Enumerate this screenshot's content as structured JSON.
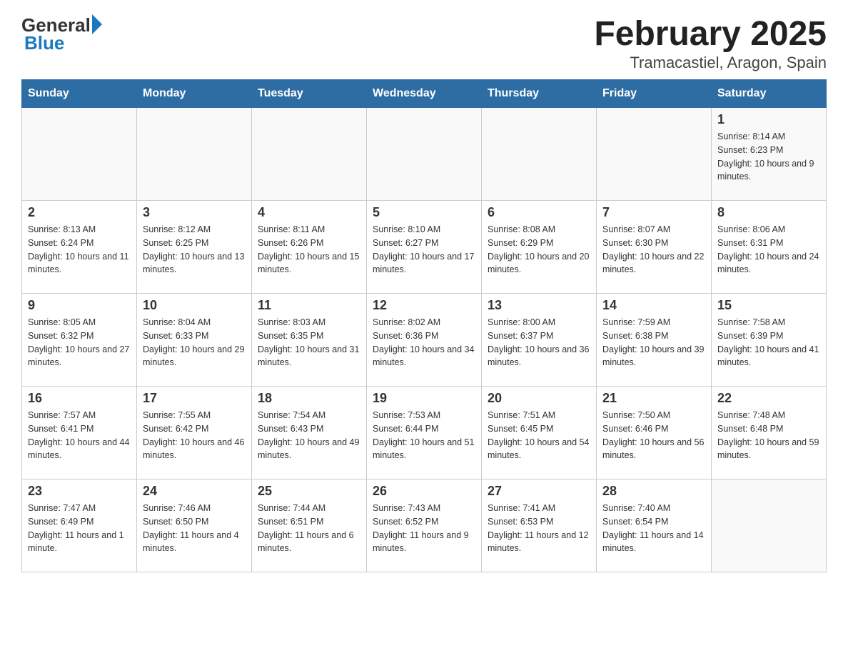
{
  "header": {
    "logo_general": "General",
    "logo_blue": "Blue",
    "title": "February 2025",
    "subtitle": "Tramacastiel, Aragon, Spain"
  },
  "weekdays": [
    "Sunday",
    "Monday",
    "Tuesday",
    "Wednesday",
    "Thursday",
    "Friday",
    "Saturday"
  ],
  "weeks": [
    [
      {
        "day": "",
        "info": ""
      },
      {
        "day": "",
        "info": ""
      },
      {
        "day": "",
        "info": ""
      },
      {
        "day": "",
        "info": ""
      },
      {
        "day": "",
        "info": ""
      },
      {
        "day": "",
        "info": ""
      },
      {
        "day": "1",
        "info": "Sunrise: 8:14 AM\nSunset: 6:23 PM\nDaylight: 10 hours and 9 minutes."
      }
    ],
    [
      {
        "day": "2",
        "info": "Sunrise: 8:13 AM\nSunset: 6:24 PM\nDaylight: 10 hours and 11 minutes."
      },
      {
        "day": "3",
        "info": "Sunrise: 8:12 AM\nSunset: 6:25 PM\nDaylight: 10 hours and 13 minutes."
      },
      {
        "day": "4",
        "info": "Sunrise: 8:11 AM\nSunset: 6:26 PM\nDaylight: 10 hours and 15 minutes."
      },
      {
        "day": "5",
        "info": "Sunrise: 8:10 AM\nSunset: 6:27 PM\nDaylight: 10 hours and 17 minutes."
      },
      {
        "day": "6",
        "info": "Sunrise: 8:08 AM\nSunset: 6:29 PM\nDaylight: 10 hours and 20 minutes."
      },
      {
        "day": "7",
        "info": "Sunrise: 8:07 AM\nSunset: 6:30 PM\nDaylight: 10 hours and 22 minutes."
      },
      {
        "day": "8",
        "info": "Sunrise: 8:06 AM\nSunset: 6:31 PM\nDaylight: 10 hours and 24 minutes."
      }
    ],
    [
      {
        "day": "9",
        "info": "Sunrise: 8:05 AM\nSunset: 6:32 PM\nDaylight: 10 hours and 27 minutes."
      },
      {
        "day": "10",
        "info": "Sunrise: 8:04 AM\nSunset: 6:33 PM\nDaylight: 10 hours and 29 minutes."
      },
      {
        "day": "11",
        "info": "Sunrise: 8:03 AM\nSunset: 6:35 PM\nDaylight: 10 hours and 31 minutes."
      },
      {
        "day": "12",
        "info": "Sunrise: 8:02 AM\nSunset: 6:36 PM\nDaylight: 10 hours and 34 minutes."
      },
      {
        "day": "13",
        "info": "Sunrise: 8:00 AM\nSunset: 6:37 PM\nDaylight: 10 hours and 36 minutes."
      },
      {
        "day": "14",
        "info": "Sunrise: 7:59 AM\nSunset: 6:38 PM\nDaylight: 10 hours and 39 minutes."
      },
      {
        "day": "15",
        "info": "Sunrise: 7:58 AM\nSunset: 6:39 PM\nDaylight: 10 hours and 41 minutes."
      }
    ],
    [
      {
        "day": "16",
        "info": "Sunrise: 7:57 AM\nSunset: 6:41 PM\nDaylight: 10 hours and 44 minutes."
      },
      {
        "day": "17",
        "info": "Sunrise: 7:55 AM\nSunset: 6:42 PM\nDaylight: 10 hours and 46 minutes."
      },
      {
        "day": "18",
        "info": "Sunrise: 7:54 AM\nSunset: 6:43 PM\nDaylight: 10 hours and 49 minutes."
      },
      {
        "day": "19",
        "info": "Sunrise: 7:53 AM\nSunset: 6:44 PM\nDaylight: 10 hours and 51 minutes."
      },
      {
        "day": "20",
        "info": "Sunrise: 7:51 AM\nSunset: 6:45 PM\nDaylight: 10 hours and 54 minutes."
      },
      {
        "day": "21",
        "info": "Sunrise: 7:50 AM\nSunset: 6:46 PM\nDaylight: 10 hours and 56 minutes."
      },
      {
        "day": "22",
        "info": "Sunrise: 7:48 AM\nSunset: 6:48 PM\nDaylight: 10 hours and 59 minutes."
      }
    ],
    [
      {
        "day": "23",
        "info": "Sunrise: 7:47 AM\nSunset: 6:49 PM\nDaylight: 11 hours and 1 minute."
      },
      {
        "day": "24",
        "info": "Sunrise: 7:46 AM\nSunset: 6:50 PM\nDaylight: 11 hours and 4 minutes."
      },
      {
        "day": "25",
        "info": "Sunrise: 7:44 AM\nSunset: 6:51 PM\nDaylight: 11 hours and 6 minutes."
      },
      {
        "day": "26",
        "info": "Sunrise: 7:43 AM\nSunset: 6:52 PM\nDaylight: 11 hours and 9 minutes."
      },
      {
        "day": "27",
        "info": "Sunrise: 7:41 AM\nSunset: 6:53 PM\nDaylight: 11 hours and 12 minutes."
      },
      {
        "day": "28",
        "info": "Sunrise: 7:40 AM\nSunset: 6:54 PM\nDaylight: 11 hours and 14 minutes."
      },
      {
        "day": "",
        "info": ""
      }
    ]
  ]
}
